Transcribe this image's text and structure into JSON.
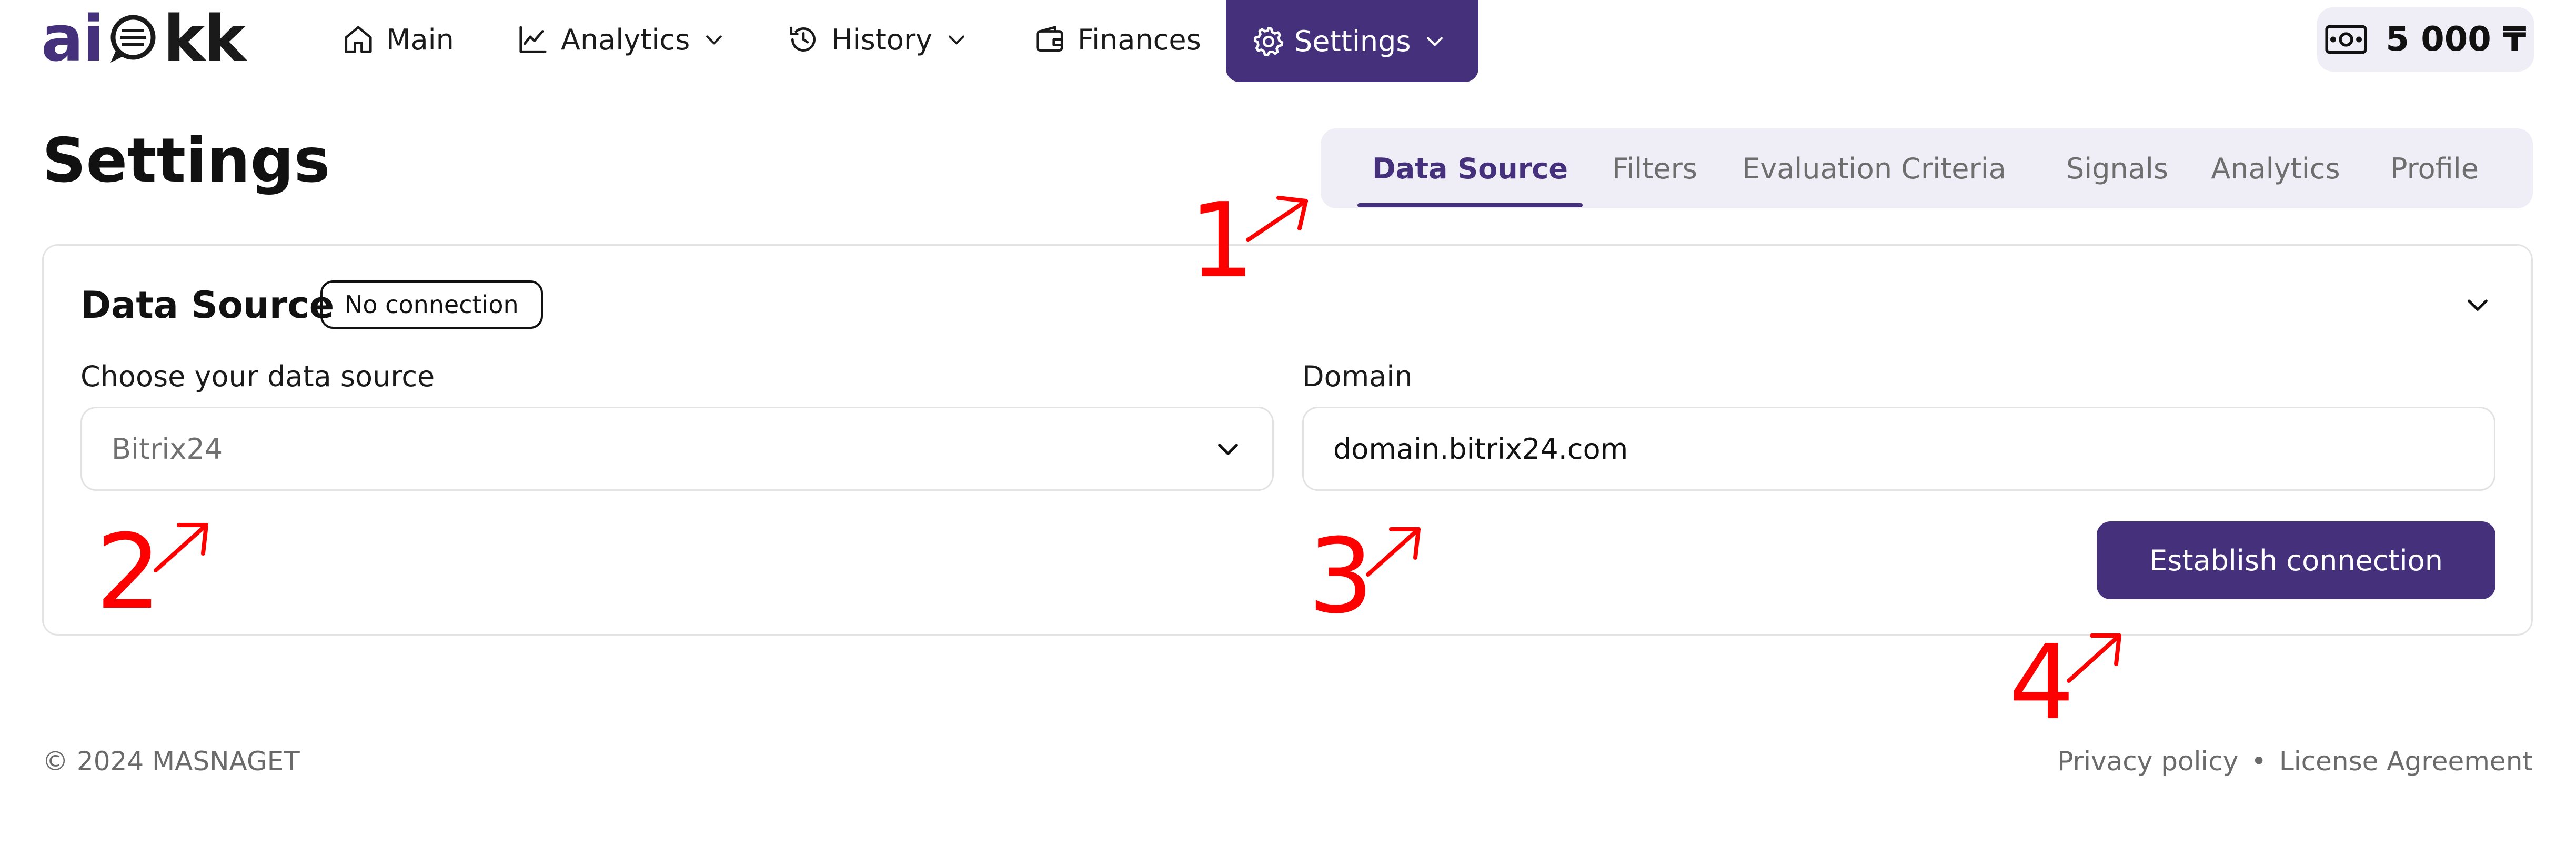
{
  "header": {
    "logo": {
      "part1": "ai",
      "part2": "kk",
      "mark_icon": "speech-bubble-icon"
    },
    "nav": [
      {
        "label": "Main",
        "icon": "home-icon"
      },
      {
        "label": "Analytics",
        "icon": "line-chart-icon"
      },
      {
        "label": "History",
        "icon": "history-icon"
      },
      {
        "label": "Finances",
        "icon": "wallet-icon"
      },
      {
        "label": "Settings",
        "icon": "gear-icon",
        "active": true
      }
    ],
    "balance": {
      "value": "5 000 ₸",
      "icon": "banknote-icon"
    }
  },
  "page": {
    "title": "Settings",
    "tabs": [
      {
        "label": "Data Source",
        "active": true
      },
      {
        "label": "Filters"
      },
      {
        "label": "Evaluation Criteria"
      },
      {
        "label": "Signals"
      },
      {
        "label": "Analytics"
      },
      {
        "label": "Profile"
      }
    ]
  },
  "card": {
    "title": "Data Source",
    "status": "No connection",
    "source_label": "Choose your data source",
    "source_value": "Bitrix24",
    "domain_label": "Domain",
    "domain_value": "domain.bitrix24.com",
    "connect_label": "Establish connection"
  },
  "annotations": [
    "1",
    "2",
    "3",
    "4"
  ],
  "footer": {
    "copyright": "© 2024 MASNAGET",
    "links": [
      "Privacy policy",
      "License Agreement"
    ],
    "separator": "•"
  },
  "colors": {
    "brand": "#45307c",
    "tab_background": "#efedf6",
    "annotation": "#ff0000",
    "muted_text": "#6a6a6a"
  }
}
